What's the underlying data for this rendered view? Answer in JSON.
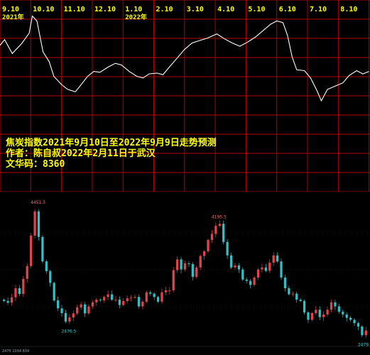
{
  "chart_data": [
    {
      "type": "line",
      "title_lines": [
        "焦炭指数2021年9月10日至2022年9月9日走势预测",
        "作者：陈自叔2022年2月11日于武汉",
        "文华码：8360"
      ],
      "month_labels": [
        "9.10",
        "10.10",
        "11.10",
        "12.10",
        "1.10",
        "2.10",
        "3.10",
        "4.10",
        "5.10",
        "6.10",
        "7.10",
        "8.10"
      ],
      "year_labels": [
        {
          "text": "2021年",
          "month_index": 0
        },
        {
          "text": "2022年",
          "month_index": 4
        }
      ],
      "y_axis_shown": false,
      "x_range_months": [
        0,
        12
      ],
      "forecast_path": [
        [
          0.0,
          60
        ],
        [
          0.15,
          67
        ],
        [
          0.4,
          50
        ],
        [
          0.7,
          62
        ],
        [
          0.95,
          75
        ],
        [
          1.05,
          96
        ],
        [
          1.2,
          90
        ],
        [
          1.4,
          52
        ],
        [
          1.6,
          40
        ],
        [
          1.75,
          22
        ],
        [
          2.0,
          12
        ],
        [
          2.2,
          6
        ],
        [
          2.45,
          3
        ],
        [
          2.6,
          10
        ],
        [
          2.85,
          22
        ],
        [
          3.05,
          28
        ],
        [
          3.25,
          27
        ],
        [
          3.5,
          33
        ],
        [
          3.75,
          38
        ],
        [
          3.95,
          36
        ],
        [
          4.2,
          28
        ],
        [
          4.45,
          22
        ],
        [
          4.65,
          20
        ],
        [
          4.85,
          25
        ],
        [
          5.1,
          26
        ],
        [
          5.3,
          24
        ],
        [
          5.5,
          33
        ],
        [
          5.75,
          44
        ],
        [
          6.0,
          55
        ],
        [
          6.25,
          63
        ],
        [
          6.5,
          66
        ],
        [
          6.75,
          69
        ],
        [
          7.05,
          74
        ],
        [
          7.3,
          68
        ],
        [
          7.55,
          63
        ],
        [
          7.8,
          59
        ],
        [
          8.05,
          64
        ],
        [
          8.3,
          70
        ],
        [
          8.55,
          78
        ],
        [
          8.8,
          86
        ],
        [
          9.0,
          90
        ],
        [
          9.2,
          88
        ],
        [
          9.35,
          72
        ],
        [
          9.5,
          46
        ],
        [
          9.65,
          30
        ],
        [
          9.9,
          29
        ],
        [
          10.1,
          20
        ],
        [
          10.3,
          5
        ],
        [
          10.45,
          -8
        ],
        [
          10.65,
          6
        ],
        [
          10.9,
          10
        ],
        [
          11.15,
          14
        ],
        [
          11.35,
          23
        ],
        [
          11.6,
          29
        ],
        [
          11.8,
          25
        ],
        [
          12.0,
          28
        ]
      ],
      "colors": {
        "background": "#000000",
        "grid": "#b30000",
        "line": "#ffffff",
        "labels": "#ffff00"
      }
    },
    {
      "type": "candlestick",
      "annotations": [
        {
          "text": "4451.5",
          "color": "#ff6666",
          "index": 8
        },
        {
          "text": "4195.5",
          "color": "#ff6666",
          "index": 55
        },
        {
          "text": "2476.5",
          "color": "#33cccc",
          "index": 16
        },
        {
          "text": "2479.0",
          "color": "#33cccc",
          "index": 93
        }
      ],
      "status_text": "2475  1034  834",
      "closes": [
        2985,
        2960,
        3040,
        3175,
        3090,
        3315,
        3505,
        3960,
        4320,
        3940,
        3575,
        3430,
        3255,
        2995,
        2875,
        2805,
        2680,
        2740,
        2800,
        2890,
        2935,
        2800,
        2905,
        2965,
        3005,
        2995,
        3045,
        3085,
        3005,
        3005,
        2925,
        2985,
        3025,
        3035,
        3045,
        2905,
        2975,
        3115,
        3095,
        3045,
        2975,
        3115,
        3145,
        3145,
        3445,
        3605,
        3455,
        3545,
        3535,
        3345,
        3485,
        3655,
        3725,
        3895,
        3985,
        4105,
        4135,
        3865,
        3665,
        3485,
        3515,
        3455,
        3305,
        3285,
        3225,
        3335,
        3455,
        3485,
        3435,
        3555,
        3665,
        3575,
        3335,
        3175,
        3085,
        3095,
        3005,
        2985,
        2815,
        2705,
        2805,
        2855,
        2745,
        2785,
        2855,
        2965,
        2905,
        2825,
        2785,
        2735,
        2705,
        2655,
        2605,
        2475,
        2545
      ],
      "y_range": [
        2350,
        4550
      ],
      "colors": {
        "background": "#0b0b0d",
        "up": "#e0454a",
        "down": "#2fc1c6",
        "grid": "#2a2a2e"
      }
    }
  ]
}
